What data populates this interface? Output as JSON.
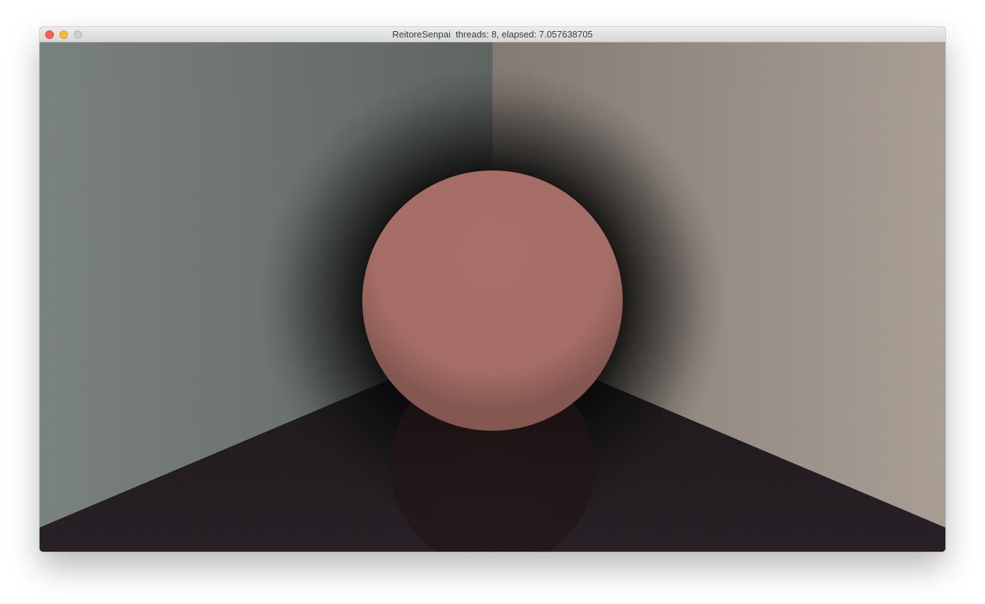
{
  "window": {
    "title": "ReitoreSenpai  threads: 8, elapsed: 7.057638705",
    "traffic_lights": [
      {
        "name": "close-button",
        "icon": "close-icon",
        "color": "#fc5f57",
        "border": "#e0443e"
      },
      {
        "name": "minimize-button",
        "icon": "minimize-icon",
        "color": "#fdbc2e",
        "border": "#dea123"
      },
      {
        "name": "zoom-button",
        "icon": "zoom-icon",
        "color": "#cfcfcf",
        "border": "#b9b9b9"
      }
    ]
  },
  "scene": {
    "left_wall_color": "#7f8883",
    "right_wall_color": "#aca096",
    "floor_color": "#211a20",
    "sphere_color": "#a66a62",
    "reflection_color": "#2a1515"
  }
}
